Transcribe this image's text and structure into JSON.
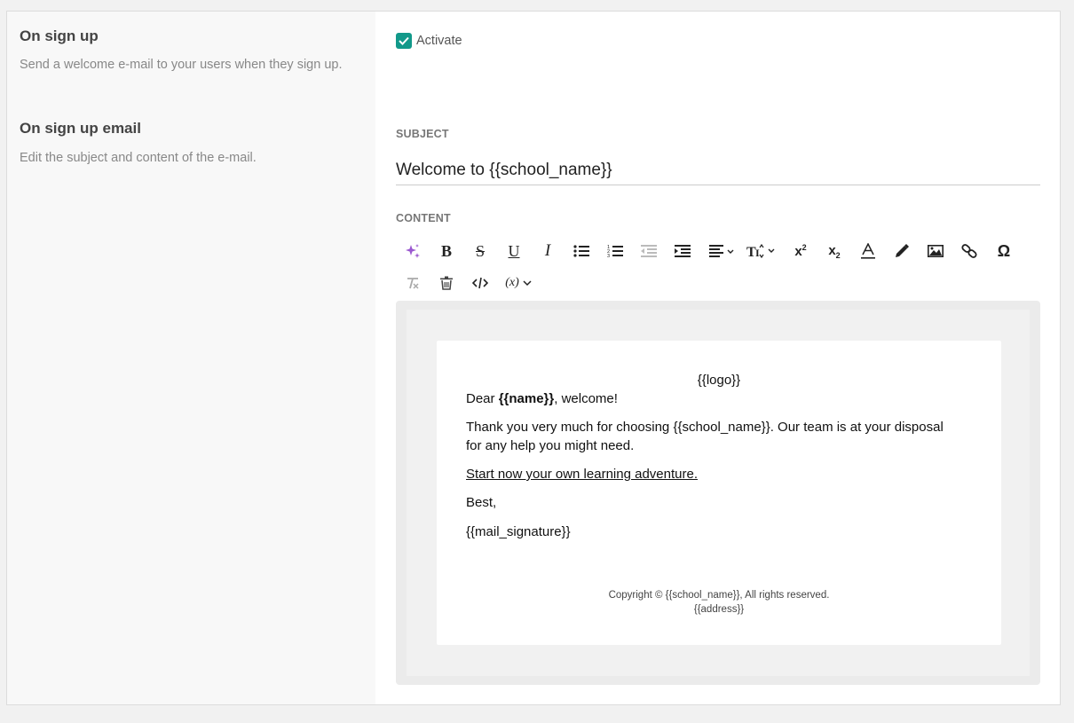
{
  "left": {
    "section1_title": "On sign up",
    "section1_desc": "Send a welcome e-mail to your users when they sign up.",
    "section2_title": "On sign up email",
    "section2_desc": "Edit the subject and content of the e-mail."
  },
  "activate": {
    "label": "Activate",
    "checked": true
  },
  "subject": {
    "label": "SUBJECT",
    "value": "Welcome to {{school_name}}"
  },
  "content": {
    "label": "CONTENT"
  },
  "toolbar": {
    "icons": [
      "ai-sparkle-icon",
      "bold-icon",
      "strikethrough-icon",
      "underline-icon",
      "italic-icon",
      "bullet-list-icon",
      "numbered-list-icon",
      "outdent-icon",
      "indent-icon",
      "align-dropdown-icon",
      "font-size-dropdown-icon",
      "superscript-icon",
      "subscript-icon",
      "font-color-icon",
      "highlight-pen-icon",
      "image-icon",
      "link-icon",
      "special-char-icon",
      "clear-format-icon",
      "delete-icon",
      "code-view-icon",
      "variables-dropdown-icon"
    ],
    "variables_label": "(x)"
  },
  "email": {
    "logo": "{{logo}}",
    "greeting_prefix": "Dear ",
    "greeting_name": "{{name}}",
    "greeting_suffix": ", welcome!",
    "body_line1": "Thank you very much for choosing {{school_name}}. Our team is at your disposal",
    "body_line2": "for any help you might need.",
    "link": "Start now your own learning adventure.",
    "closing": "Best,",
    "signature": "{{mail_signature}}",
    "footer_line1": "Copyright © {{school_name}}, All rights reserved.",
    "footer_line2": "{{address}}"
  },
  "colors": {
    "accent": "#12998a",
    "link": "#2d9bd3",
    "ai": "#9b59d0"
  }
}
